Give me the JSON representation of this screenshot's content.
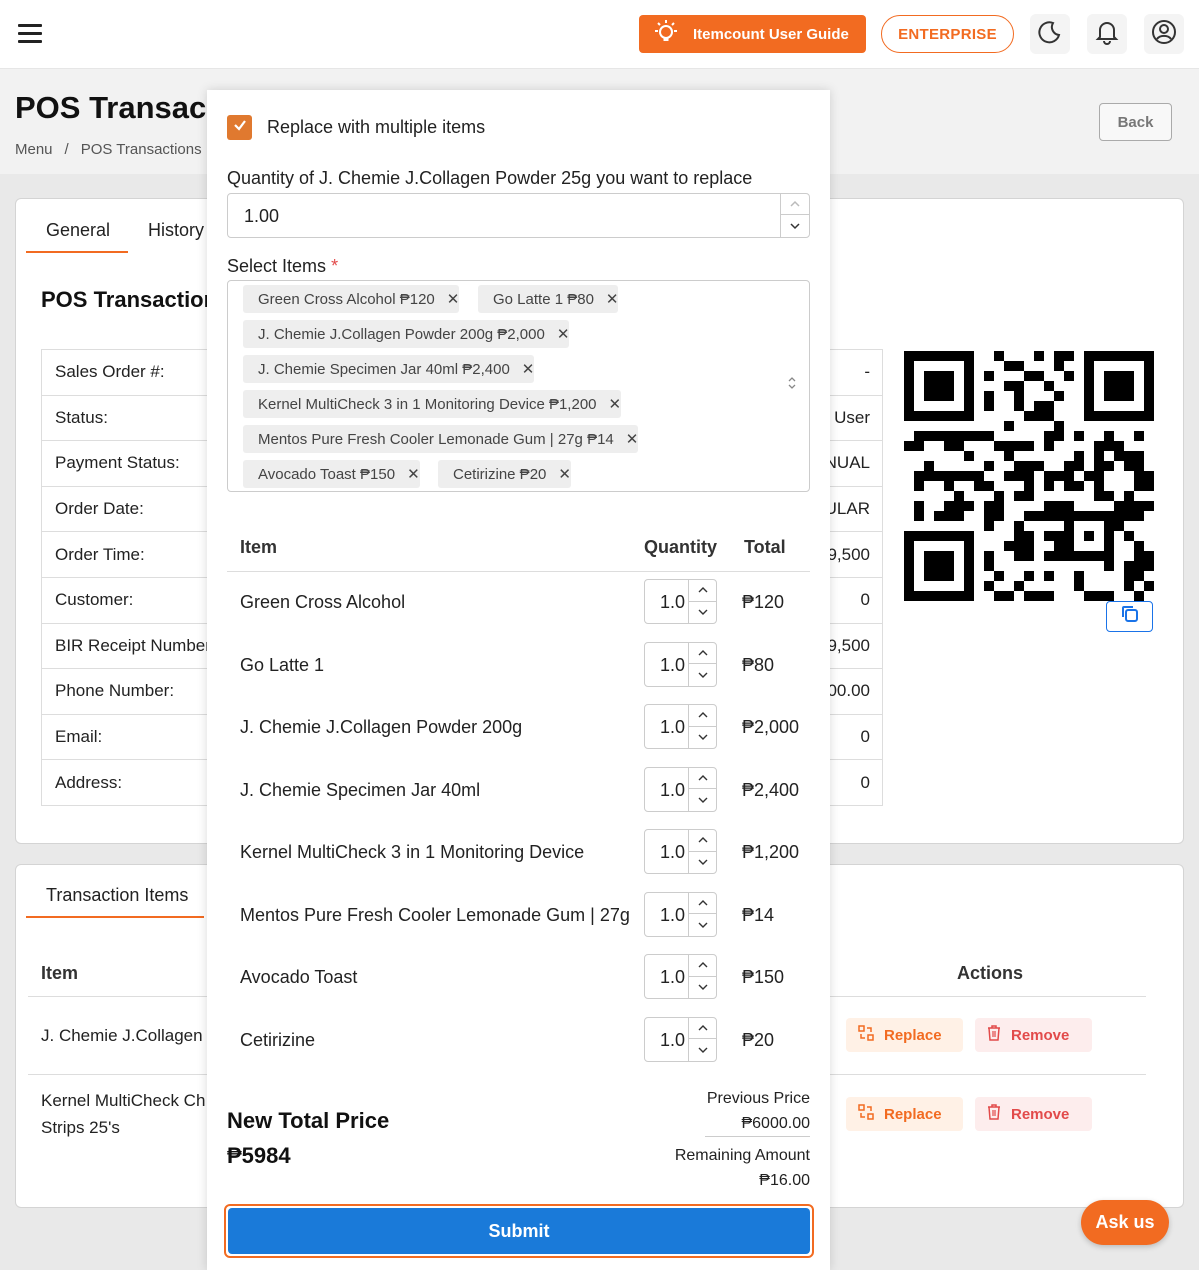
{
  "topbar": {
    "guide_label": "Itemcount User Guide",
    "enterprise_label": "ENTERPRISE",
    "accent_color": "#f26b21"
  },
  "page": {
    "title": "POS Transac",
    "breadcrumb": [
      "Menu",
      "/",
      "POS Transactions"
    ],
    "back_label": "Back"
  },
  "general_card": {
    "tabs": [
      "General",
      "History"
    ],
    "title": "POS Transaction",
    "info_labels": [
      "Sales Order #:",
      "Status:",
      "Payment Status:",
      "Order Date:",
      "Order Time:",
      "Customer:",
      "BIR Receipt Number",
      "Phone Number:",
      "Email:",
      "Address:"
    ],
    "right_values": [
      "-",
      "User",
      "NUAL",
      "ULAR",
      "9,500",
      "0",
      "9,500",
      "00.00",
      "0",
      "0"
    ]
  },
  "transaction_items": {
    "tab": "Transaction Items",
    "headers": {
      "item": "Item",
      "actions": "Actions"
    },
    "rows": [
      {
        "item": "J. Chemie J.Collagen",
        "item2": ""
      },
      {
        "item": "Kernel MultiCheck Ch",
        "item2": "Strips 25's"
      }
    ],
    "replace_label": "Replace",
    "remove_label": "Remove"
  },
  "ask_us": "Ask us",
  "modal": {
    "checkbox_label": "Replace with multiple items",
    "quantity_label": "Quantity of J. Chemie J.Collagen Powder 25g you want to replace",
    "quantity_value": "1.00",
    "select_label": "Select Items",
    "required_mark": "*",
    "chips": [
      "Green Cross Alcohol ₱120",
      "Go Latte 1 ₱80",
      "J. Chemie J.Collagen Powder 200g ₱2,000",
      "J. Chemie Specimen Jar 40ml ₱2,400",
      "Kernel MultiCheck 3 in 1 Monitoring Device ₱1,200",
      "Mentos Pure Fresh Cooler Lemonade Gum | 27g ₱14",
      "Avocado Toast ₱150",
      "Cetirizine ₱20"
    ],
    "table_headers": {
      "item": "Item",
      "quantity": "Quantity",
      "total": "Total"
    },
    "items": [
      {
        "name": "Green Cross Alcohol",
        "qty": "1.0",
        "total": "₱120"
      },
      {
        "name": "Go Latte 1",
        "qty": "1.0",
        "total": "₱80"
      },
      {
        "name": "J. Chemie J.Collagen Powder 200g",
        "qty": "1.0",
        "total": "₱2,000"
      },
      {
        "name": "J. Chemie Specimen Jar 40ml",
        "qty": "1.0",
        "total": "₱2,400"
      },
      {
        "name": "Kernel MultiCheck 3 in 1 Monitoring Device",
        "qty": "1.0",
        "total": "₱1,200"
      },
      {
        "name": "Mentos Pure Fresh Cooler Lemonade Gum | 27g",
        "qty": "1.0",
        "total": "₱14"
      },
      {
        "name": "Avocado Toast",
        "qty": "1.0",
        "total": "₱150"
      },
      {
        "name": "Cetirizine",
        "qty": "1.0",
        "total": "₱20"
      }
    ],
    "new_total_label": "New Total Price",
    "new_total_value": "₱5984",
    "previous_price_label": "Previous Price",
    "previous_price_value": "₱6000.00",
    "remaining_label": "Remaining Amount",
    "remaining_value": "₱16.00",
    "submit_label": "Submit"
  }
}
